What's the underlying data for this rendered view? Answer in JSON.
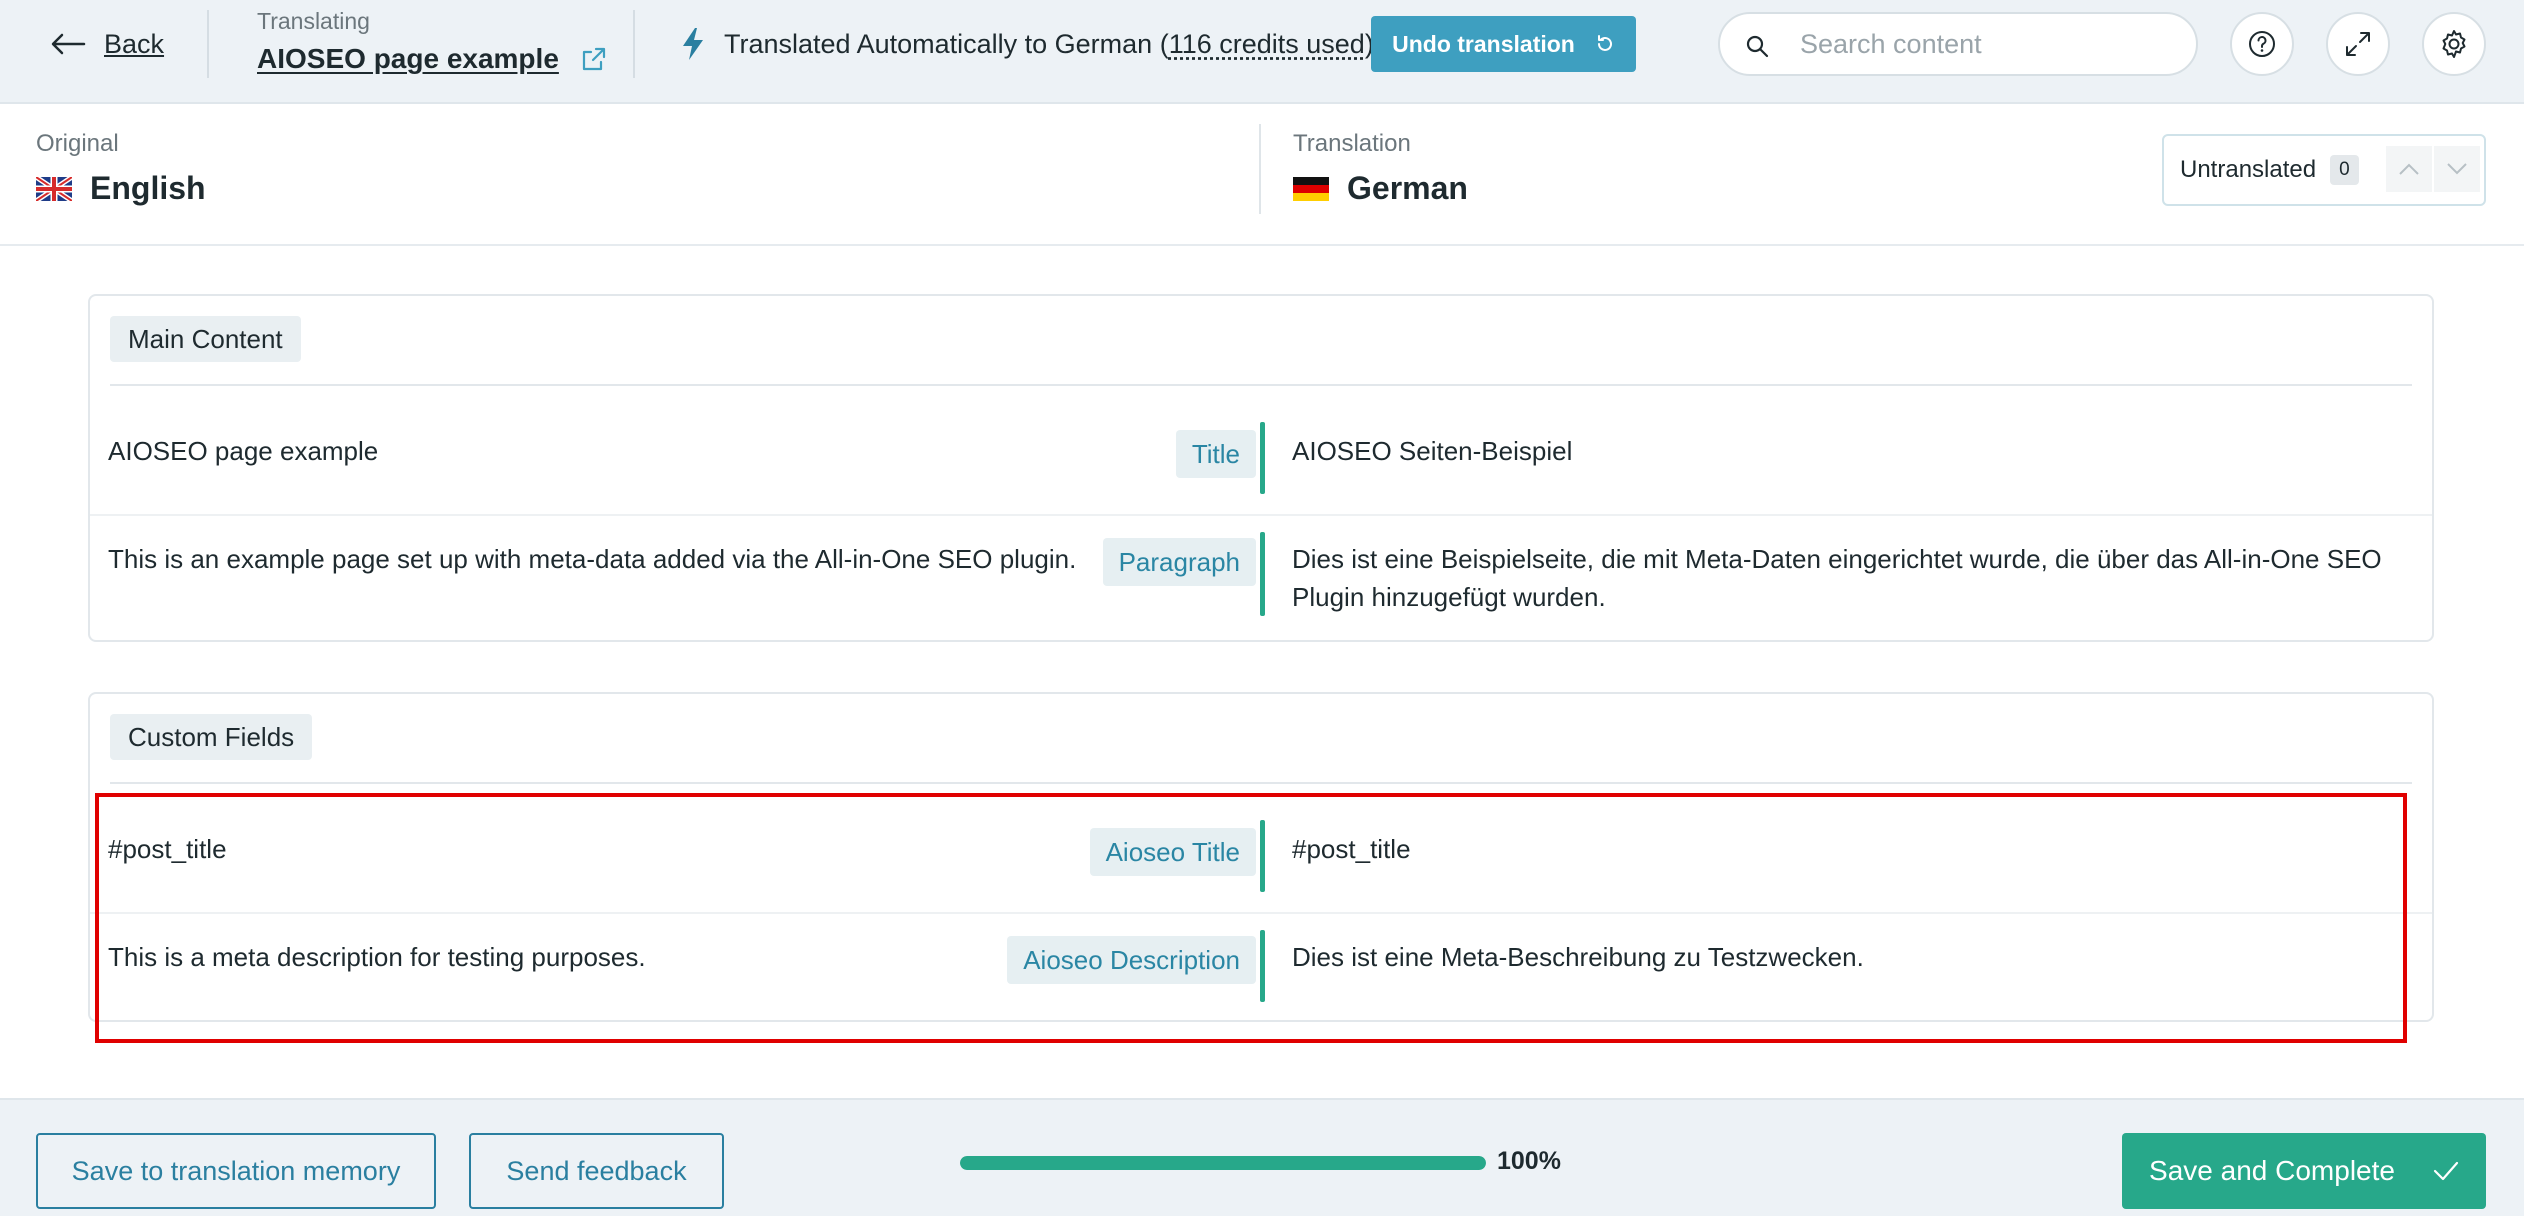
{
  "header": {
    "back_label": "Back",
    "translating_caption": "Translating",
    "page_title": "AIOSEO page example",
    "auto_note_prefix": "Translated Automatically to German (",
    "credits": "116 credits used",
    "auto_note_suffix": ")",
    "undo_label": "Undo translation",
    "search_placeholder": "Search content"
  },
  "languages": {
    "original_caption": "Original",
    "original_name": "English",
    "translation_caption": "Translation",
    "translation_name": "German",
    "untranslated_label": "Untranslated",
    "untranslated_count": "0"
  },
  "sections": [
    {
      "title": "Main Content",
      "rows": [
        {
          "source": "AIOSEO page example",
          "field": "Title",
          "target": "AIOSEO Seiten-Beispiel"
        },
        {
          "source": "This is an example page set up with meta-data added via the All-in-One SEO plugin.",
          "field": "Paragraph",
          "target": "Dies ist eine Beispielseite, die mit Meta-Daten eingerichtet wurde, die über das All-in-One SEO Plugin hinzugefügt wurden."
        }
      ]
    },
    {
      "title": "Custom Fields",
      "rows": [
        {
          "source": "#post_title",
          "field": "Aioseo Title",
          "target": "#post_title"
        },
        {
          "source": "This is a meta description for testing purposes.",
          "field": "Aioseo Description",
          "target": "Dies ist eine Meta-Beschreibung zu Testzwecken."
        }
      ]
    }
  ],
  "footer": {
    "save_memory_label": "Save to translation memory",
    "feedback_label": "Send feedback",
    "progress_label": "100%",
    "progress_value": 1.0,
    "complete_label": "Save and Complete"
  },
  "colors": {
    "accent_teal": "#27a88a",
    "accent_blue": "#3e9fc0",
    "highlight_red": "#e00000"
  },
  "icons": [
    "arrow-left-icon",
    "external-link-icon",
    "lightning-icon",
    "undo-icon",
    "search-icon",
    "help-icon",
    "expand-icon",
    "gear-icon",
    "chevron-up-icon",
    "chevron-down-icon",
    "checkmark-icon",
    "uk-flag-icon",
    "germany-flag-icon"
  ]
}
